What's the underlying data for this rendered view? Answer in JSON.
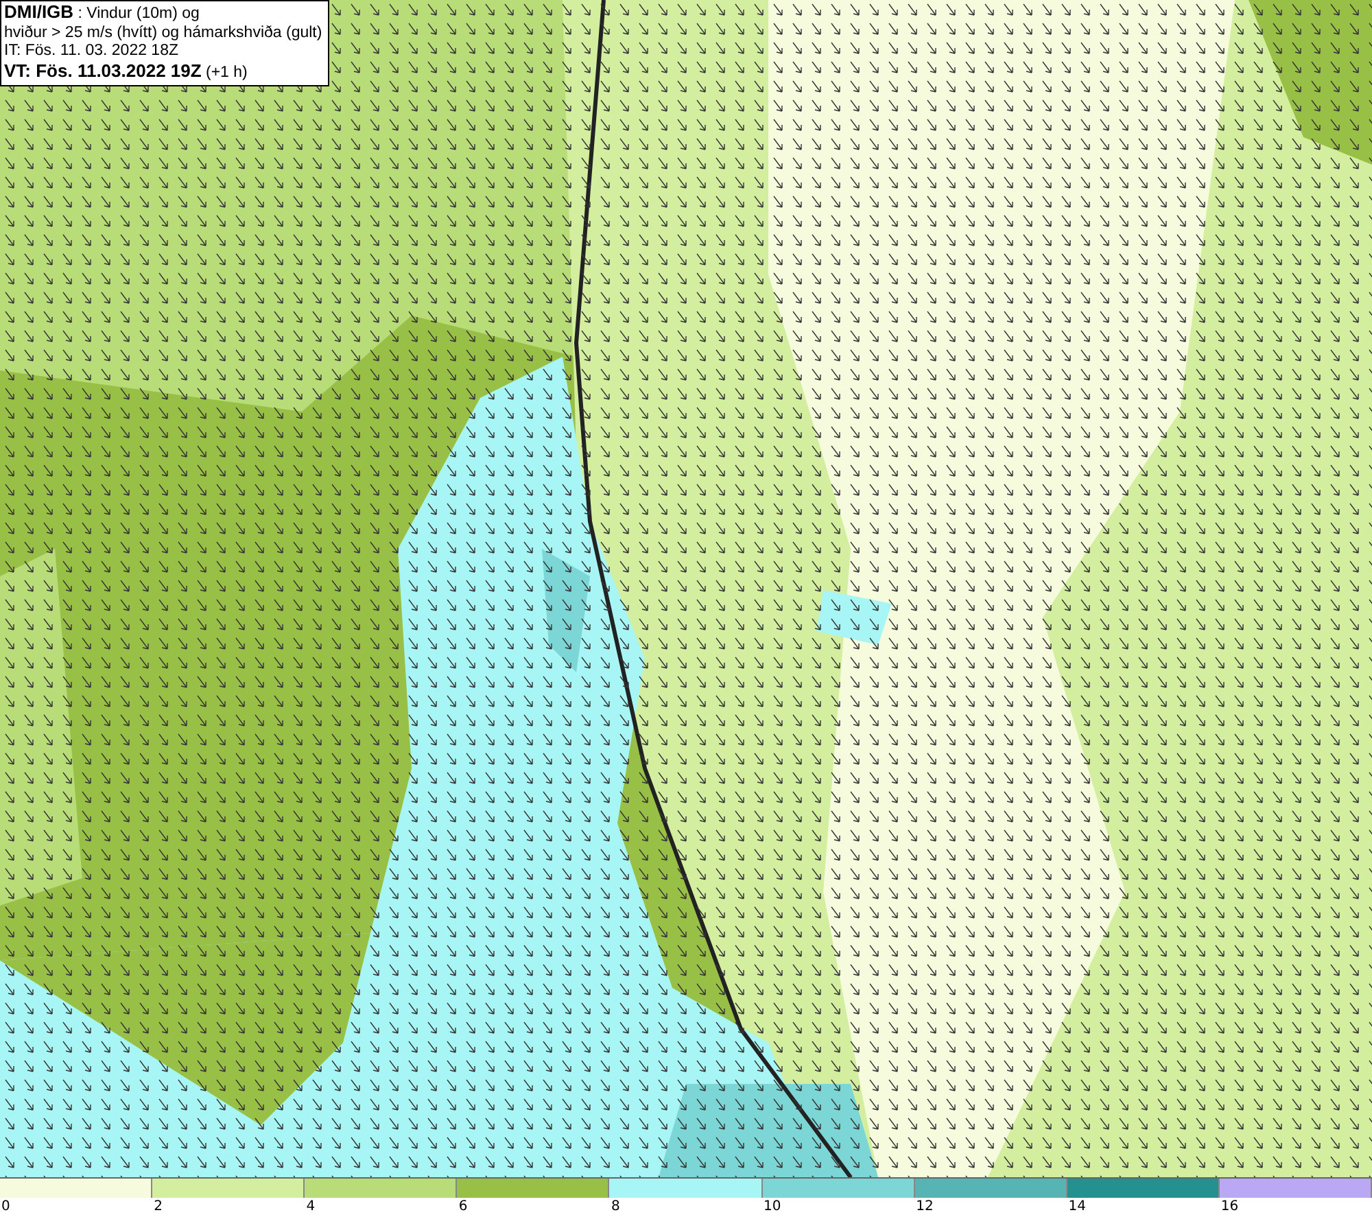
{
  "info_box": {
    "lines": [
      "**DMI/IGB** : Vindur (10m) og",
      "hviður > 25 m/s (hvítt) og hámarkshviða (gult)",
      "IT: Fös. 11. 03. 2022 18Z",
      "**VT: Fös. 11.03.2022 19Z** (+1 h)"
    ]
  },
  "legend": [
    {
      "label": "0",
      "color": "#f5fbdc"
    },
    {
      "label": "2",
      "color": "#d4eea0"
    },
    {
      "label": "4",
      "color": "#b8dc78"
    },
    {
      "label": "6",
      "color": "#98c046"
    },
    {
      "label": "8",
      "color": "#a8f5f5"
    },
    {
      "label": "10",
      "color": "#7dd6d6"
    },
    {
      "label": "12",
      "color": "#56b4b4"
    },
    {
      "label": "14",
      "color": "#259090"
    },
    {
      "label": "16",
      "color": "#bba8f5"
    }
  ]
}
